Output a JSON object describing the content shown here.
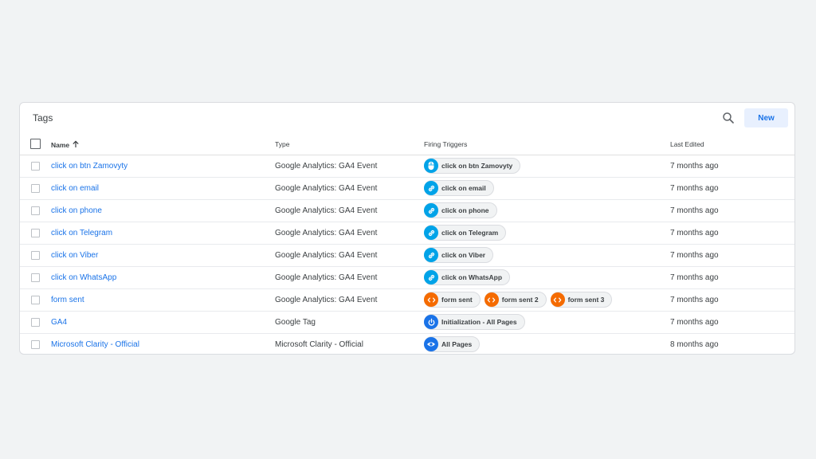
{
  "card": {
    "title": "Tags",
    "new_label": "New"
  },
  "columns": {
    "name": "Name",
    "type": "Type",
    "triggers": "Firing Triggers",
    "edited": "Last Edited"
  },
  "colors": {
    "link": "#1a73e8",
    "trigger_blue": "#00a3e8",
    "trigger_orange": "#f56b00",
    "trigger_darkblue": "#1a73e8"
  },
  "rows": [
    {
      "name": "click on btn Zamovyty",
      "type": "Google Analytics: GA4 Event",
      "edited": "7 months ago",
      "triggers": [
        {
          "label": "click on btn Zamovyty",
          "icon": "mouse-icon",
          "color": "#00a3e8"
        }
      ]
    },
    {
      "name": "click on email",
      "type": "Google Analytics: GA4 Event",
      "edited": "7 months ago",
      "triggers": [
        {
          "label": "click on email",
          "icon": "link-icon",
          "color": "#00a3e8"
        }
      ]
    },
    {
      "name": "click on phone",
      "type": "Google Analytics: GA4 Event",
      "edited": "7 months ago",
      "triggers": [
        {
          "label": "click on phone",
          "icon": "link-icon",
          "color": "#00a3e8"
        }
      ]
    },
    {
      "name": "click on Telegram",
      "type": "Google Analytics: GA4 Event",
      "edited": "7 months ago",
      "triggers": [
        {
          "label": "click on Telegram",
          "icon": "link-icon",
          "color": "#00a3e8"
        }
      ]
    },
    {
      "name": "click on Viber",
      "type": "Google Analytics: GA4 Event",
      "edited": "7 months ago",
      "triggers": [
        {
          "label": "click on Viber",
          "icon": "link-icon",
          "color": "#00a3e8"
        }
      ]
    },
    {
      "name": "click on WhatsApp",
      "type": "Google Analytics: GA4 Event",
      "edited": "7 months ago",
      "triggers": [
        {
          "label": "click on WhatsApp",
          "icon": "link-icon",
          "color": "#00a3e8"
        }
      ]
    },
    {
      "name": "form sent",
      "type": "Google Analytics: GA4 Event",
      "edited": "7 months ago",
      "triggers": [
        {
          "label": "form sent",
          "icon": "code-icon",
          "color": "#f56b00"
        },
        {
          "label": "form sent 2",
          "icon": "code-icon",
          "color": "#f56b00"
        },
        {
          "label": "form sent 3",
          "icon": "code-icon",
          "color": "#f56b00"
        }
      ]
    },
    {
      "name": "GA4",
      "type": "Google Tag",
      "edited": "7 months ago",
      "triggers": [
        {
          "label": "Initialization - All Pages",
          "icon": "power-icon",
          "color": "#1a73e8"
        }
      ]
    },
    {
      "name": "Microsoft Clarity - Official",
      "type": "Microsoft Clarity - Official",
      "edited": "8 months ago",
      "triggers": [
        {
          "label": "All Pages",
          "icon": "eye-icon",
          "color": "#1a73e8"
        }
      ]
    }
  ]
}
